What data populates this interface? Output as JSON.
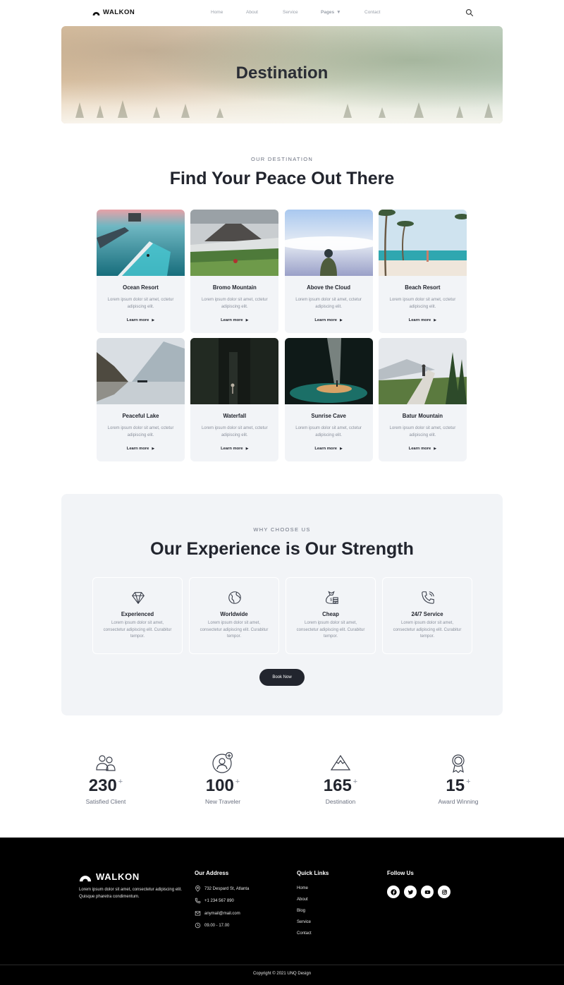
{
  "brand": {
    "name": "WALKON"
  },
  "nav": {
    "items": [
      {
        "label": "Home"
      },
      {
        "label": "About"
      },
      {
        "label": "Service"
      },
      {
        "label": "Pages"
      },
      {
        "label": "Contact"
      }
    ],
    "search_icon": "search-icon"
  },
  "hero": {
    "title": "Destination"
  },
  "destinations": {
    "eyebrow": "OUR DESTINATION",
    "heading": "Find Your Peace Out There",
    "cards": [
      {
        "title": "Ocean Resort",
        "desc": "Lorem ipsum dolor sit amet, cctetur adipiscing elit.",
        "link": "Learn more"
      },
      {
        "title": "Bromo Mountain",
        "desc": "Lorem ipsum dolor sit amet, cctetur adipiscing elit.",
        "link": "Learn more"
      },
      {
        "title": "Above the Cloud",
        "desc": "Lorem ipsum dolor sit amet, cctetur adipiscing elit.",
        "link": "Learn more"
      },
      {
        "title": "Beach Resort",
        "desc": "Lorem ipsum dolor sit amet, cctetur adipiscing elit.",
        "link": "Learn more"
      },
      {
        "title": "Peaceful Lake",
        "desc": "Lorem ipsum dolor sit amet, cctetur adipiscing elit.",
        "link": "Learn more"
      },
      {
        "title": "Waterfall",
        "desc": "Lorem ipsum dolor sit amet, cctetur adipiscing elit.",
        "link": "Learn more"
      },
      {
        "title": "Sunrise Cave",
        "desc": "Lorem ipsum dolor sit amet, cctetur adipiscing elit.",
        "link": "Learn more"
      },
      {
        "title": "Batur Mountain",
        "desc": "Lorem ipsum dolor sit amet, cctetur adipiscing elit.",
        "link": "Learn more"
      }
    ]
  },
  "why": {
    "eyebrow": "WHY CHOOSE US",
    "heading": "Our Experience is Our Strength",
    "features": [
      {
        "title": "Experienced",
        "desc": "Lorem ipsum dolor sit amet, consectetur adipiscing elit. Curabitur tempor.",
        "icon": "diamond-icon"
      },
      {
        "title": "Worldwide",
        "desc": "Lorem ipsum dolor sit amet, consectetur adipiscing elit. Curabitur tempor.",
        "icon": "globe-icon"
      },
      {
        "title": "Cheap",
        "desc": "Lorem ipsum dolor sit amet, consectetur adipiscing elit. Curabitur tempor.",
        "icon": "money-bag-icon"
      },
      {
        "title": "24/7 Service",
        "desc": "Lorem ipsum dolor sit amet, consectetur adipiscing elit. Curabitur tempor.",
        "icon": "phone-call-icon"
      }
    ],
    "button": "Book Now"
  },
  "stats": [
    {
      "value": "230",
      "plus": "+",
      "label": "Satisfied Client",
      "icon": "users-icon"
    },
    {
      "value": "100",
      "plus": "+",
      "label": "New Traveler",
      "icon": "add-user-icon"
    },
    {
      "value": "165",
      "plus": "+",
      "label": "Destination",
      "icon": "mountain-icon"
    },
    {
      "value": "15",
      "plus": "+",
      "label": "Award Winning",
      "icon": "award-icon"
    }
  ],
  "footer": {
    "about": "Lorem ipsum dolor sit amet, consectetur adipiscing elit. Quisque pharetra condimentum.",
    "address_title": "Our Address",
    "address": [
      {
        "text": "732 Despard St, Atlanta",
        "icon": "map-pin-icon"
      },
      {
        "text": "+1 234 567 890",
        "icon": "phone-icon"
      },
      {
        "text": "anymail@mail.com",
        "icon": "mail-icon"
      },
      {
        "text": "09.00 - 17.00",
        "icon": "clock-icon"
      }
    ],
    "links_title": "Quick Links",
    "links": [
      "Home",
      "About",
      "Blog",
      "Service",
      "Contact"
    ],
    "follow_title": "Follow Us",
    "socials": [
      "facebook-icon",
      "twitter-icon",
      "youtube-icon",
      "instagram-icon"
    ],
    "copyright": "Copyright © 2021 UNQ Design"
  },
  "colors": {
    "dark": "#22252e",
    "muted": "#8a909c",
    "panel": "#f2f4f7",
    "footer": "#000000"
  }
}
